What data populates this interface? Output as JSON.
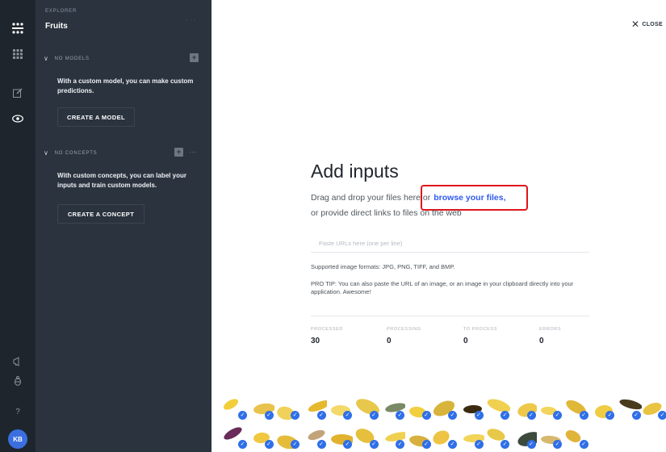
{
  "rail": {
    "icons": [
      "logo-icon",
      "apps-grid-icon",
      "edit-icon",
      "eye-icon",
      "megaphone-icon",
      "bug-icon",
      "help-icon"
    ],
    "help_label": "?",
    "avatar_initials": "KB"
  },
  "sidebar": {
    "workspace_label": "EXPLORER",
    "workspace_name": "Fruits",
    "workspace_dots": "· · ·",
    "models": {
      "heading": "NO MODELS",
      "add_label": "+",
      "text": "With a custom model, you can make custom predictions.",
      "button": "CREATE A MODEL"
    },
    "concepts": {
      "heading": "NO CONCEPTS",
      "add_label": "+",
      "more_label": "···",
      "text": "With custom concepts, you can label your inputs and train custom models.",
      "button": "CREATE A CONCEPT"
    }
  },
  "main": {
    "close_label": "CLOSE",
    "title": "Add inputs",
    "drag_text": "Drag and drop your files here or",
    "browse_link": "browse your files,",
    "direct_links_text": "or provide direct links to files on the web",
    "url_placeholder": "Paste URLs here (one per line)",
    "formats_text": "Supported image formats: JPG, PNG, TIFF, and BMP.",
    "tip_text": "PRO TIP: You can also paste the URL of an image, or an image in your clipboard directly into your application. Awesome!",
    "stats": [
      {
        "label": "PROCESSED",
        "value": "30"
      },
      {
        "label": "PROCESSING",
        "value": "0"
      },
      {
        "label": "TO PROCESS",
        "value": "0"
      },
      {
        "label": "ERRORS",
        "value": "0"
      }
    ]
  },
  "thumbnails": {
    "rows": [
      [
        "#f2ce3a",
        "#e8c24a",
        "#f0d25a",
        "#e6b82e",
        "#f4d86a",
        "#e8c84c",
        "#7a8a66",
        "#f1cf40",
        "#d9b43a",
        "#3a2a10",
        "#f0d050",
        "#eec848",
        "#f3d45c",
        "#e0b838",
        "#f0cc44",
        "#4a3a1e",
        "#e8c440"
      ],
      [
        "#6a2a5a",
        "#f0c840",
        "#e4bc3a",
        "#c2a47a",
        "#e2b22e",
        "#e6c03c",
        "#f0d050",
        "#d8b040",
        "#eec444",
        "#f2d458",
        "#e8c848",
        "#3c4a3c",
        "#d8b86c",
        "#e0b43a"
      ]
    ]
  }
}
